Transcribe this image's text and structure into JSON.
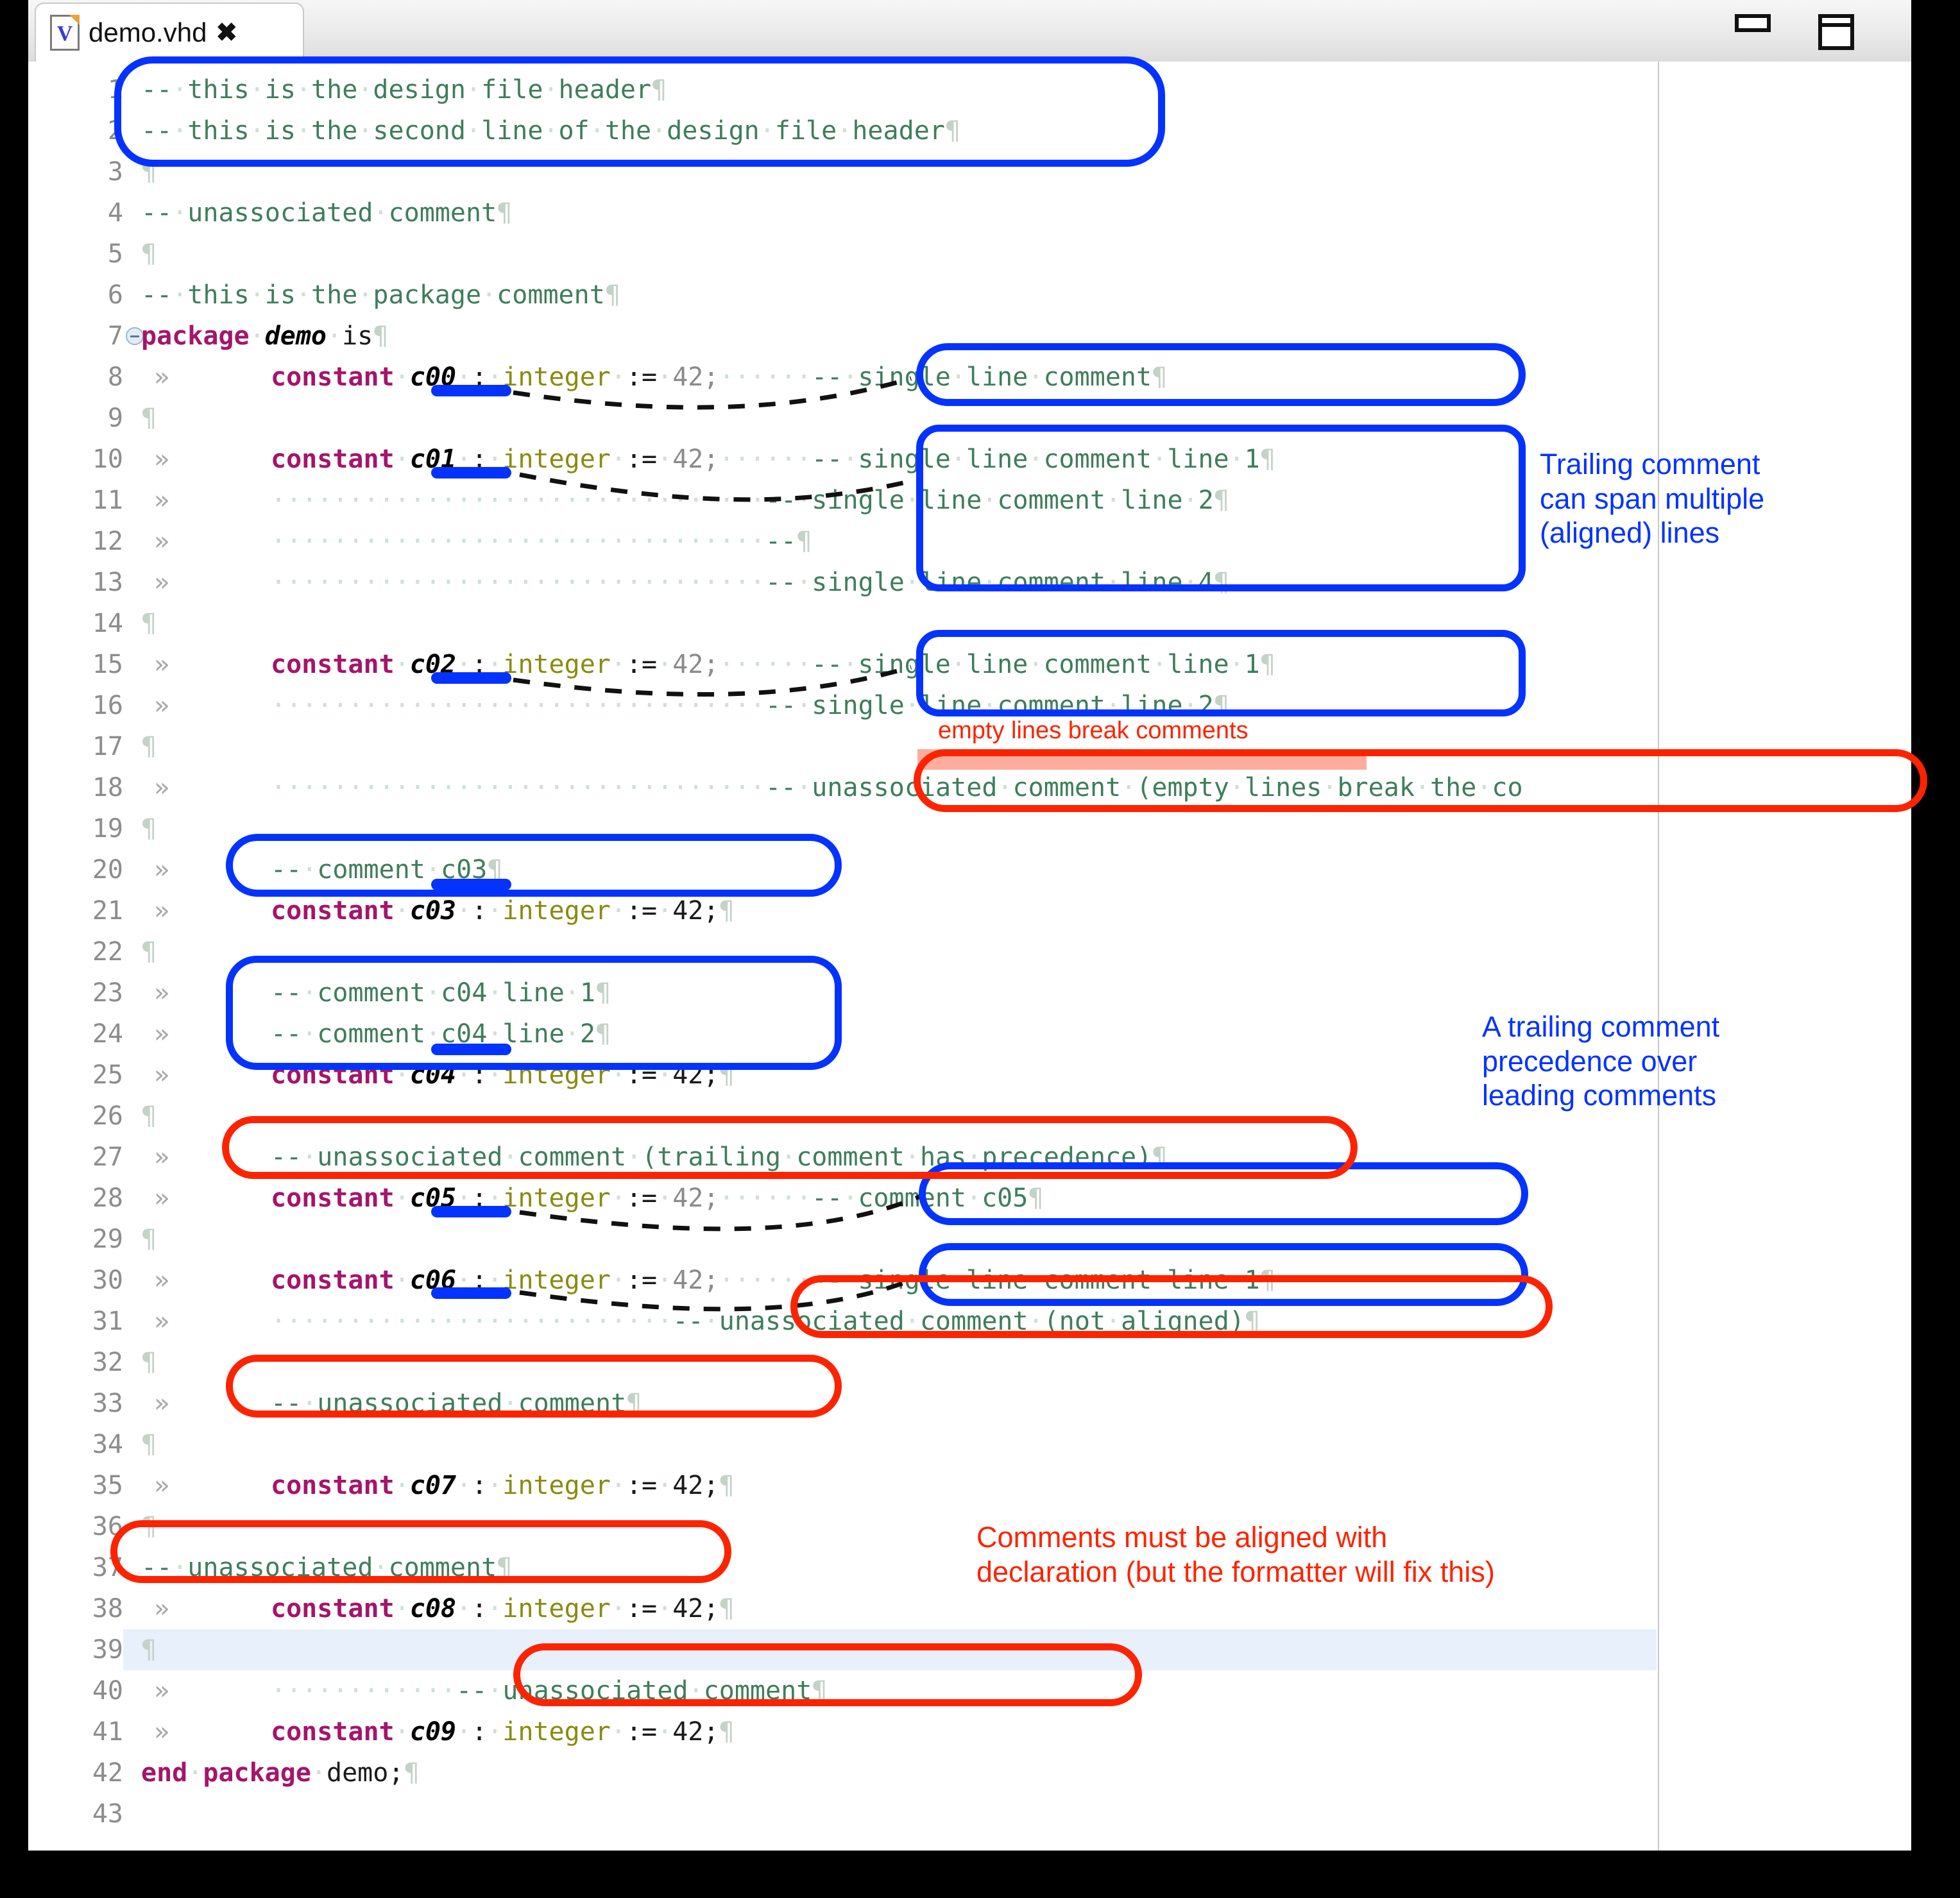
{
  "window": {
    "tab_title": "demo.vhd",
    "tab_icon": "vhdl-file-icon",
    "tab_icon_letter": "V",
    "close_glyph": "✖",
    "minimize_label": "Minimize",
    "maximize_label": "Maximize",
    "colors": {
      "comment": "#3f7d5c",
      "keyword": "#a4156b",
      "identifier": "#000000",
      "type": "#8a8a12",
      "literal": "#8b8b8b",
      "annotation_blue": "#0433ff",
      "annotation_red": "#fc2400",
      "highlight_row": "#e8f0fb"
    }
  },
  "editor": {
    "tab_marker_glyph": "»",
    "pilcrow_glyph": "¶",
    "space_dot_glyph": "·",
    "fold_marker_line": 7,
    "highlighted_line": 39,
    "total_lines": 43,
    "lines": [
      {
        "no": 1,
        "tab": false,
        "indent": false,
        "text": "--·this·is·the·design·file·header¶"
      },
      {
        "no": 2,
        "tab": false,
        "indent": false,
        "text": "--·this·is·the·second·line·of·the·design·file·header¶"
      },
      {
        "no": 3,
        "tab": false,
        "indent": false,
        "text": "¶"
      },
      {
        "no": 4,
        "tab": false,
        "indent": false,
        "text": "--·unassociated·comment¶"
      },
      {
        "no": 5,
        "tab": false,
        "indent": false,
        "text": "¶"
      },
      {
        "no": 6,
        "tab": false,
        "indent": false,
        "text": "--·this·is·the·package·comment¶"
      },
      {
        "no": 7,
        "tab": false,
        "indent": false,
        "text": "package·demo·is¶"
      },
      {
        "no": 8,
        "tab": true,
        "indent": true,
        "text": "constant·c00·:·integer·:=·42;······--·single·line·comment¶"
      },
      {
        "no": 9,
        "tab": false,
        "indent": false,
        "text": "¶"
      },
      {
        "no": 10,
        "tab": true,
        "indent": true,
        "text": "constant·c01·:·integer·:=·42;······--·single·line·comment·line·1¶"
      },
      {
        "no": 11,
        "tab": true,
        "indent": true,
        "text": "································--·single·line·comment·line·2¶"
      },
      {
        "no": 12,
        "tab": true,
        "indent": true,
        "text": "································--¶"
      },
      {
        "no": 13,
        "tab": true,
        "indent": true,
        "text": "································--·single·line·comment·line·4¶"
      },
      {
        "no": 14,
        "tab": false,
        "indent": false,
        "text": "¶"
      },
      {
        "no": 15,
        "tab": true,
        "indent": true,
        "text": "constant·c02·:·integer·:=·42;······--·single·line·comment·line·1¶"
      },
      {
        "no": 16,
        "tab": true,
        "indent": true,
        "text": "································--·single·line·comment·line·2¶"
      },
      {
        "no": 17,
        "tab": false,
        "indent": false,
        "text": "¶"
      },
      {
        "no": 18,
        "tab": true,
        "indent": true,
        "text": "································--·unassociated·comment·(empty·lines·break·the·co"
      },
      {
        "no": 19,
        "tab": false,
        "indent": false,
        "text": "¶"
      },
      {
        "no": 20,
        "tab": true,
        "indent": true,
        "text": "--·comment·c03¶"
      },
      {
        "no": 21,
        "tab": true,
        "indent": true,
        "text": "constant·c03·:·integer·:=·42;¶"
      },
      {
        "no": 22,
        "tab": false,
        "indent": false,
        "text": "¶"
      },
      {
        "no": 23,
        "tab": true,
        "indent": true,
        "text": "--·comment·c04·line·1¶"
      },
      {
        "no": 24,
        "tab": true,
        "indent": true,
        "text": "--·comment·c04·line·2¶"
      },
      {
        "no": 25,
        "tab": true,
        "indent": true,
        "text": "constant·c04·:·integer·:=·42;¶"
      },
      {
        "no": 26,
        "tab": false,
        "indent": false,
        "text": "¶"
      },
      {
        "no": 27,
        "tab": true,
        "indent": true,
        "text": "--·unassociated·comment·(trailing·comment·has·precedence)¶"
      },
      {
        "no": 28,
        "tab": true,
        "indent": true,
        "text": "constant·c05·:·integer·:=·42;······--·comment·c05¶"
      },
      {
        "no": 29,
        "tab": false,
        "indent": false,
        "text": "¶"
      },
      {
        "no": 30,
        "tab": true,
        "indent": true,
        "text": "constant·c06·:·integer·:=·42;······--·single·line·comment·line·1¶"
      },
      {
        "no": 31,
        "tab": true,
        "indent": true,
        "text": "··························--·unassociated·comment·(not·aligned)¶"
      },
      {
        "no": 32,
        "tab": false,
        "indent": false,
        "text": "¶"
      },
      {
        "no": 33,
        "tab": true,
        "indent": true,
        "text": "--·unassociated·comment¶"
      },
      {
        "no": 34,
        "tab": false,
        "indent": false,
        "text": "¶"
      },
      {
        "no": 35,
        "tab": true,
        "indent": true,
        "text": "constant·c07·:·integer·:=·42;¶"
      },
      {
        "no": 36,
        "tab": false,
        "indent": false,
        "text": "¶"
      },
      {
        "no": 37,
        "tab": false,
        "indent": false,
        "text": "--·unassociated·comment¶"
      },
      {
        "no": 38,
        "tab": true,
        "indent": true,
        "text": "constant·c08·:·integer·:=·42;¶"
      },
      {
        "no": 39,
        "tab": false,
        "indent": false,
        "text": "¶"
      },
      {
        "no": 40,
        "tab": true,
        "indent": true,
        "text": "············--·unassociated·comment¶"
      },
      {
        "no": 41,
        "tab": true,
        "indent": true,
        "text": "constant·c09·:·integer·:=·42;¶"
      },
      {
        "no": 42,
        "tab": false,
        "indent": false,
        "text": "end·package·demo;¶"
      },
      {
        "no": 43,
        "tab": false,
        "indent": false,
        "text": ""
      }
    ]
  },
  "annotations": {
    "note_trailing_span": "Trailing comment\ncan span multiple\n(aligned) lines",
    "note_empty_lines": "empty lines break comments",
    "note_precedence": "A trailing comment\nprecedence over\nleading comments",
    "note_aligned": "Comments must be aligned with\ndeclaration (but the formatter will fix this)"
  }
}
